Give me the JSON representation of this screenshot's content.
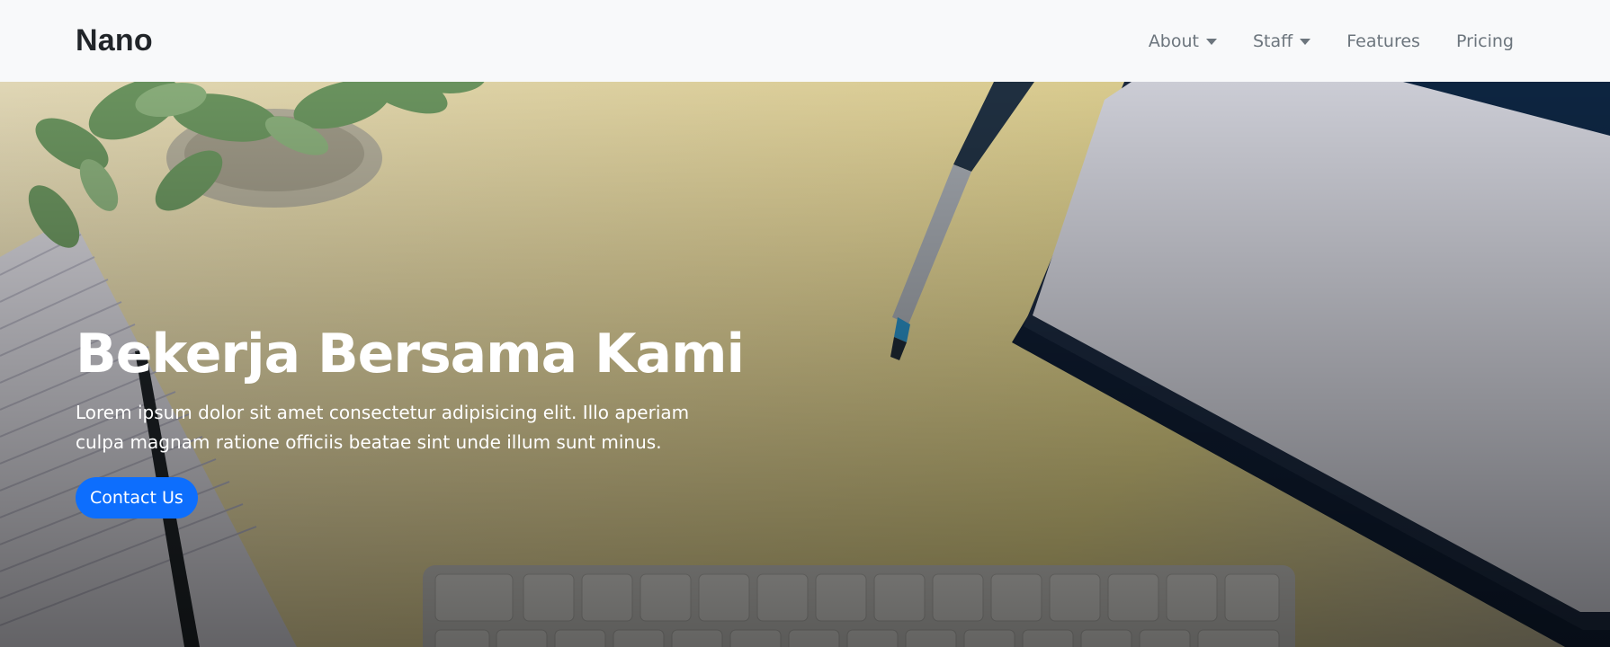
{
  "navbar": {
    "brand": "Nano",
    "links": [
      {
        "label": "About",
        "dropdown": true
      },
      {
        "label": "Staff",
        "dropdown": true
      },
      {
        "label": "Features",
        "dropdown": false
      },
      {
        "label": "Pricing",
        "dropdown": false
      }
    ]
  },
  "hero": {
    "title": "Bekerja Bersama Kami",
    "text": "Lorem ipsum dolor sit amet consectetur adipisicing elit. Illo aperiam culpa magnam ratione officiis beatae sint unde illum sunt minus.",
    "button_label": "Contact Us"
  },
  "colors": {
    "navbar_bg": "#f8f9fa",
    "brand_text": "#212529",
    "nav_link": "#6c757d",
    "button_primary": "#0d6efd",
    "hero_text": "#ffffff"
  }
}
